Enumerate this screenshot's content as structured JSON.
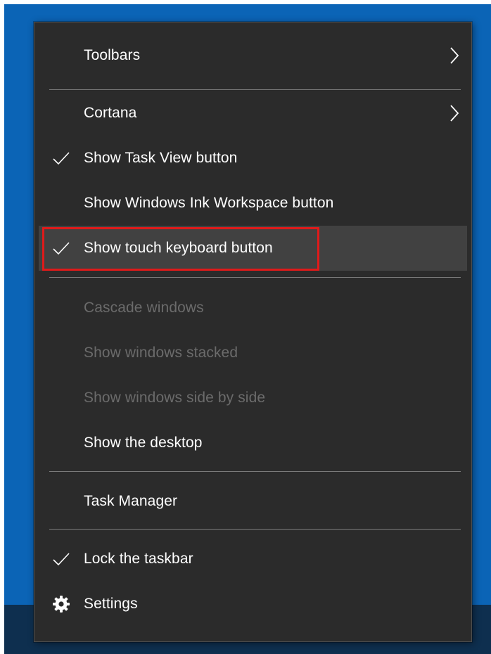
{
  "colors": {
    "desktop": "#0b64b6",
    "taskbar": "#0e2f4f",
    "menu_background": "#2b2b2b",
    "menu_text": "#ffffff",
    "disabled_text": "#6b6b6b",
    "hover_background": "#414141",
    "annotation_box": "#e01a1a"
  },
  "menu": {
    "items": [
      {
        "label": "Toolbars",
        "checked": false,
        "submenu": true,
        "enabled": true,
        "icon": "chevron-right-icon"
      },
      {
        "label": "Cortana",
        "checked": false,
        "submenu": true,
        "enabled": true,
        "icon": "chevron-right-icon"
      },
      {
        "label": "Show Task View button",
        "checked": true,
        "submenu": false,
        "enabled": true,
        "icon": "checkmark-icon"
      },
      {
        "label": "Show Windows Ink Workspace button",
        "checked": false,
        "submenu": false,
        "enabled": true
      },
      {
        "label": "Show touch keyboard button",
        "checked": true,
        "submenu": false,
        "enabled": true,
        "highlighted": true,
        "icon": "checkmark-icon"
      },
      {
        "label": "Cascade windows",
        "checked": false,
        "submenu": false,
        "enabled": false
      },
      {
        "label": "Show windows stacked",
        "checked": false,
        "submenu": false,
        "enabled": false
      },
      {
        "label": "Show windows side by side",
        "checked": false,
        "submenu": false,
        "enabled": false
      },
      {
        "label": "Show the desktop",
        "checked": false,
        "submenu": false,
        "enabled": true
      },
      {
        "label": "Task Manager",
        "checked": false,
        "submenu": false,
        "enabled": true
      },
      {
        "label": "Lock the taskbar",
        "checked": true,
        "submenu": false,
        "enabled": true,
        "icon": "checkmark-icon"
      },
      {
        "label": "Settings",
        "checked": false,
        "submenu": false,
        "enabled": true,
        "icon": "gear-icon"
      }
    ]
  }
}
